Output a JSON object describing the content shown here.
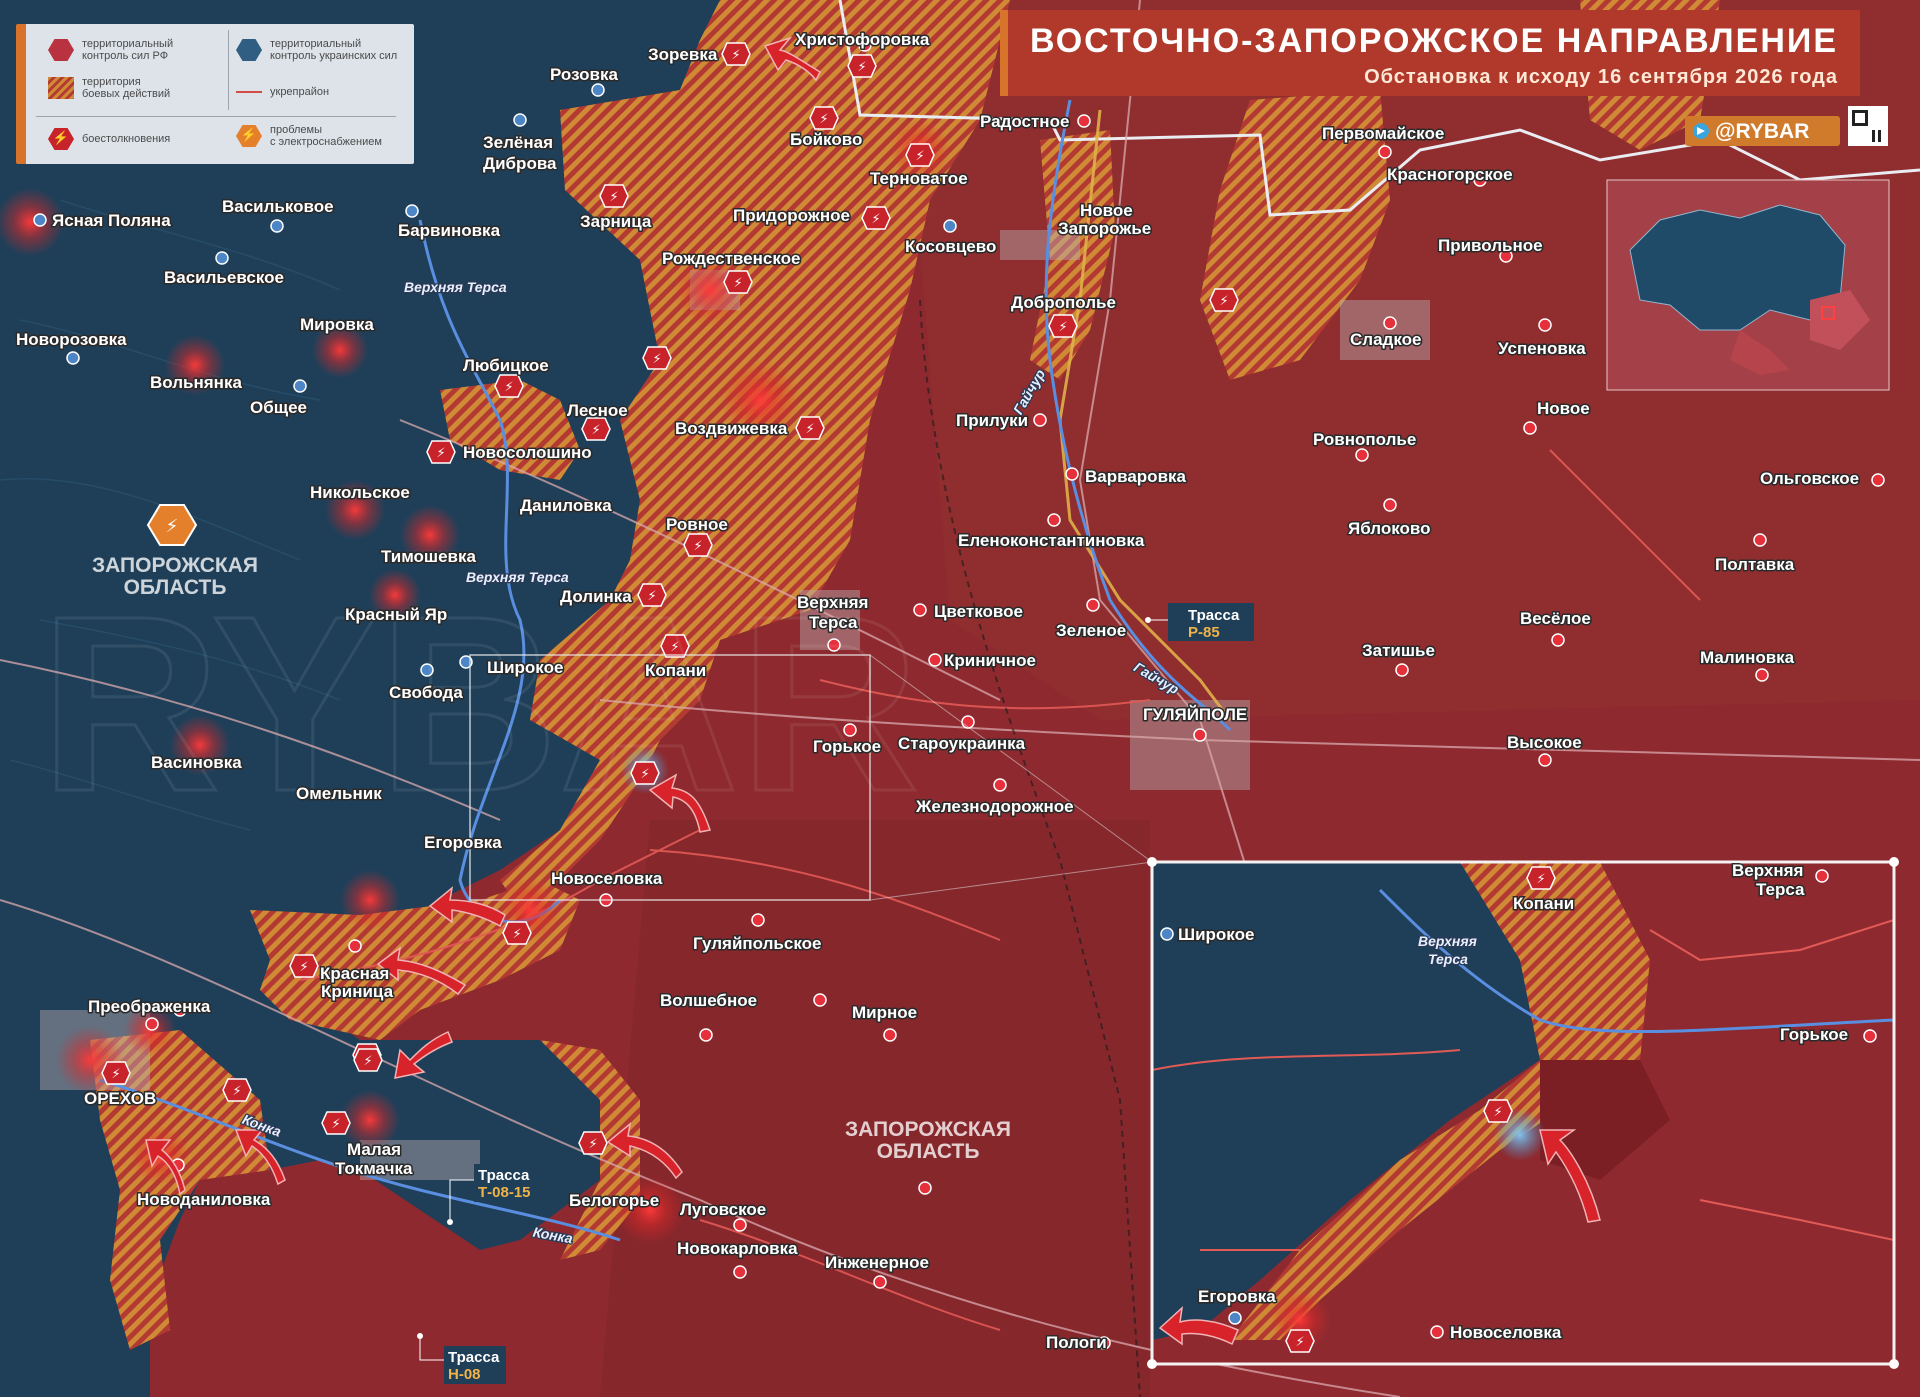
{
  "header": {
    "title": "ВОСТОЧНО-ЗАПОРОЖСКОЕ НАПРАВЛЕНИЕ",
    "subtitle": "Обстановка к исходу 16 сентября 2026 года",
    "brand": "@RYBAR"
  },
  "legend": {
    "ru_control": "территориальный\nконтроль сил РФ",
    "ua_control": "территориальный\nконтроль украинских сил",
    "combat_zone": "территория\nбоевых действий",
    "fortifications": "укрепрайон",
    "clashes": "боестолкновения",
    "power_issues": "проблемы\nс электроснабжением"
  },
  "colors": {
    "ru_territory": "#8e2a2f",
    "ua_territory": "#1f3f58",
    "combat_hatch_orange": "#d08a35",
    "clash_marker": "#c8222a",
    "title_bar": "#b0392b",
    "accent_orange": "#d8732b"
  },
  "region_labels": {
    "west": "ЗАПОРОЖСКАЯ ОБЛАСТЬ",
    "center": "ЗАПОРОЖСКАЯ ОБЛАСТЬ"
  },
  "rivers": {
    "verkhnyaya_tersa": "Верхняя Терса",
    "gaychur": "Гайчур",
    "konka": "Конка"
  },
  "roads": {
    "r85": {
      "prefix": "Трасса",
      "code": "Р-85"
    },
    "t0815": {
      "prefix": "Трасса",
      "code": "Т-08-15"
    },
    "h08": {
      "prefix": "Трасса",
      "code": "Н-08"
    }
  },
  "settlements": {
    "zorevka": "Зоревка",
    "khristoforovka": "Христофоровка",
    "rozovka": "Розовка",
    "boykovo": "Бойково",
    "radostnoe": "Радостное",
    "pervomayskoe": "Первомайское",
    "krasnogorskoe": "Красногорское",
    "zelenaya_dibrova": "Зелёная\nДиброва",
    "ternovatoe": "Терноватое",
    "novoe_zaporozhye": "Новое\nЗапорожье",
    "yasnaya_polyana": "Ясная Поляна",
    "vasilkovoe": "Васильковое",
    "barvinovka": "Барвиновка",
    "zarnitsa": "Зарница",
    "pridorozhnoe": "Придорожное",
    "kosovtsevo": "Косовцево",
    "privolnoe": "Привольное",
    "vasilevskoe": "Васильевское",
    "rozhdestvenskoe": "Рождественское",
    "dobropolye": "Доброполье",
    "sladkoe": "Сладкое",
    "novorozovka": "Новорозовка",
    "mirovka": "Мировка",
    "uspenovka": "Успеновка",
    "volnyanka": "Вольнянка",
    "lyubitskoe": "Любицкое",
    "obshchee": "Общее",
    "lesnoe": "Лесное",
    "vozdvizhevka": "Воздвижевка",
    "prilukі": "Прилуки",
    "novoe": "Новое",
    "novosoloshino": "Новосолошино",
    "rovnopole": "Ровнополье",
    "varvarovka": "Варваровка",
    "olgovskoe": "Ольговское",
    "nikolskoe": "Никольское",
    "danilovka": "Даниловка",
    "yablokovo": "Яблоково",
    "rovnoe": "Ровное",
    "timoshevka": "Тимошевка",
    "elenokonstantinovka": "Еленоконстантиновка",
    "poltavka": "Полтавка",
    "dolinka": "Долинка",
    "krasny_yar": "Красный Яр",
    "verkhnyaya_tersa": "Верхняя\nТерса",
    "tsvetkovoe": "Цветковое",
    "zelenoe": "Зеленое",
    "veseloe": "Весёлое",
    "shirokoe": "Широкое",
    "kopani": "Копани",
    "krinichnoe": "Криничное",
    "zatishye": "Затишье",
    "malinovka": "Малиновка",
    "svoboda": "Свобода",
    "gulyaypole": "ГУЛЯЙПОЛЕ",
    "gorkoe": "Горькое",
    "staroukrainka": "Староукраинка",
    "vysokoe": "Высокое",
    "vasinovka": "Васиновка",
    "omelnik": "Омельник",
    "zheleznodorozhnoe": "Железнодорожное",
    "egorovka": "Егоровка",
    "novoselovka": "Новоселовка",
    "gulyaypolskoe": "Гуляйпольское",
    "krasnaya_krinitsa": "Красная\nКриница",
    "preobrazhenka": "Преображенка",
    "volshebnoe": "Волшебное",
    "mirnoe": "Мирное",
    "orekhov": "ОРЕХОВ",
    "malaya_tokmachka": "Малая\nТокмачка",
    "novodanilovka": "Новоданиловка",
    "belogorye": "Белогорье",
    "lugovskoe": "Луговское",
    "novokarlovka": "Новокарловка",
    "inzhenernoe": "Инженерное",
    "pologi": "Пологи"
  },
  "inset": {
    "shirokoe": "Широкое",
    "kopani": "Копани",
    "verkhnyaya_tersa": "Верхняя\nТерса",
    "river": "Верхняя\nТерса",
    "gorkoe": "Горькое",
    "egorovka": "Егоровка",
    "novoselovka": "Новоселовка"
  },
  "watermark": "RYBAR"
}
